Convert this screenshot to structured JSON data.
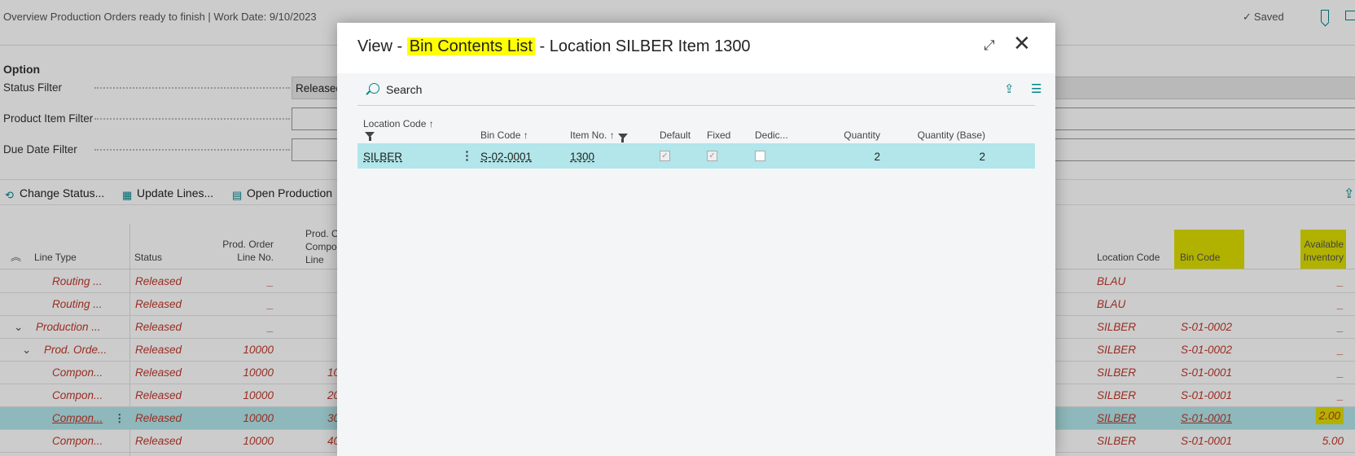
{
  "page": {
    "title": "Overview Production Orders ready to finish | Work Date: 9/10/2023",
    "saved": "Saved",
    "option_header": "Option",
    "fields": [
      {
        "label": "Status Filter",
        "value": "Released"
      },
      {
        "label": "Product Item Filter",
        "value": ""
      },
      {
        "label": "Due Date Filter",
        "value": ""
      }
    ],
    "actions": [
      "Change Status...",
      "Update Lines...",
      "Open Production"
    ],
    "columns": {
      "line_type": "Line Type",
      "status": "Status",
      "prod_order_line_no": "Prod. Order Line No.",
      "prod_order_comp_line": "Prod. O\nCompo\nLine",
      "location_code": "Location Code",
      "bin_code": "Bin Code",
      "available_inventory": "Available Inventory"
    },
    "rows": [
      {
        "line_type": "Routing ...",
        "status": "Released",
        "prod_line": "_",
        "comp_line": "",
        "location": "BLAU",
        "bin": "",
        "avail": "_"
      },
      {
        "line_type": "Routing ...",
        "status": "Released",
        "prod_line": "_",
        "comp_line": "",
        "location": "BLAU",
        "bin": "",
        "avail": "_"
      },
      {
        "line_type": "Production ...",
        "status": "Released",
        "prod_line": "_",
        "comp_line": "",
        "location": "SILBER",
        "bin": "S-01-0002",
        "avail": "_"
      },
      {
        "line_type": "Prod. Orde...",
        "status": "Released",
        "prod_line": "10000",
        "comp_line": "",
        "location": "SILBER",
        "bin": "S-01-0002",
        "avail": "_"
      },
      {
        "line_type": "Compon...",
        "status": "Released",
        "prod_line": "10000",
        "comp_line": "10",
        "location": "SILBER",
        "bin": "S-01-0001",
        "avail": "_"
      },
      {
        "line_type": "Compon...",
        "status": "Released",
        "prod_line": "10000",
        "comp_line": "20",
        "location": "SILBER",
        "bin": "S-01-0001",
        "avail": "_"
      },
      {
        "line_type": "Compon...",
        "status": "Released",
        "prod_line": "10000",
        "comp_line": "30",
        "location": "SILBER",
        "bin": "S-01-0001",
        "avail": "2.00"
      },
      {
        "line_type": "Compon...",
        "status": "Released",
        "prod_line": "10000",
        "comp_line": "40",
        "location": "SILBER",
        "bin": "S-01-0001",
        "avail": "5.00"
      }
    ]
  },
  "dialog": {
    "title_prefix": "View - ",
    "title_highlight": "Bin Contents List",
    "title_suffix": " - Location SILBER Item 1300",
    "search_label": "Search",
    "columns": {
      "location_code": "Location Code",
      "bin_code": "Bin Code",
      "item_no": "Item No.",
      "default": "Default",
      "fixed": "Fixed",
      "dedicated": "Dedic...",
      "quantity": "Quantity",
      "quantity_base": "Quantity (Base)"
    },
    "sort_arrow": "↑",
    "row": {
      "location_code": "SILBER",
      "bin_code": "S-02-0001",
      "item_no": "1300",
      "default": true,
      "fixed": true,
      "dedicated": false,
      "quantity": "2",
      "quantity_base": "2"
    }
  },
  "icons": {
    "check": "✓",
    "expand": "⤢",
    "close": "✕",
    "menu": "⋮",
    "share": "⇪",
    "list": "☰",
    "collapse": "︽",
    "chevron": "⌄"
  }
}
